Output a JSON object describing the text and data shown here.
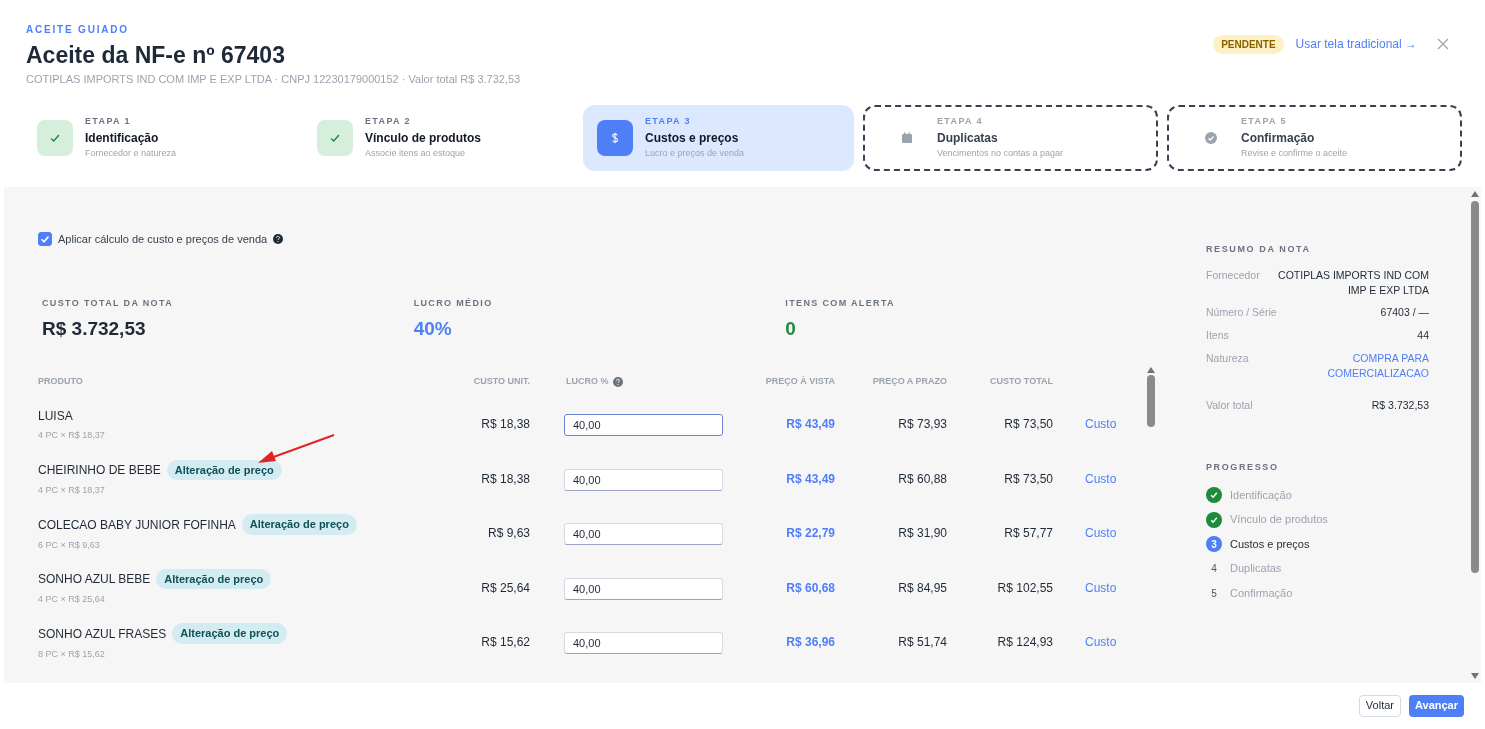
{
  "header": {
    "eyebrow": "ACEITE GUIADO",
    "title": "Aceite da NF-e nº 67403",
    "subtitle": "COTIPLAS IMPORTS IND COM IMP E EXP LTDA · CNPJ 12230179000152 · Valor total R$ 3.732,53",
    "status_badge": "PENDENTE",
    "traditional_link": "Usar tela tradicional →"
  },
  "steps": [
    {
      "label": "ETAPA 1",
      "title": "Identificação",
      "description": "Fornecedor e natureza",
      "kind": "done"
    },
    {
      "label": "ETAPA 2",
      "title": "Vínculo de produtos",
      "description": "Associe itens ao estoque",
      "kind": "done"
    },
    {
      "label": "ETAPA 3",
      "title": "Custos e preços",
      "description": "Lucro e preços de venda",
      "kind": "current"
    },
    {
      "label": "ETAPA 4",
      "title": "Duplicatas",
      "description": "Vencimentos no contas a pagar",
      "kind": "pending"
    },
    {
      "label": "ETAPA 5",
      "title": "Confirmação",
      "description": "Revise e confirme o aceite",
      "kind": "pending"
    }
  ],
  "apply_checkbox": {
    "label": "Aplicar cálculo de custo e preços de venda",
    "checked": true
  },
  "stats": [
    {
      "label": "CUSTO TOTAL DA NOTA",
      "value": "R$ 3.732,53",
      "color": "#1f2937"
    },
    {
      "label": "LUCRO MÉDIO",
      "value": "40%",
      "color": "#4f7ff7"
    },
    {
      "label": "ITENS COM ALERTA",
      "value": "0",
      "color": "#1e8a3c"
    }
  ],
  "table": {
    "columns": [
      "PRODUTO",
      "CUSTO UNIT.",
      "LUCRO %",
      "PREÇO À VISTA",
      "PREÇO A PRAZO",
      "CUSTO TOTAL"
    ],
    "rows": [
      {
        "product": "LUISA",
        "detail": "4 PC × R$ 18,37",
        "badge": "",
        "unit_cost": "R$ 18,38",
        "profit": "40,00",
        "focused": true,
        "cash_price": "R$ 43,49",
        "term_price": "R$ 73,93",
        "total_cost": "R$ 73,50",
        "action": "Custo"
      },
      {
        "product": "CHEIRINHO DE BEBE",
        "detail": "4 PC × R$ 18,37",
        "badge": "Alteração de preço",
        "unit_cost": "R$ 18,38",
        "profit": "40,00",
        "focused": false,
        "cash_price": "R$ 43,49",
        "term_price": "R$ 60,88",
        "total_cost": "R$ 73,50",
        "action": "Custo"
      },
      {
        "product": "COLECAO BABY JUNIOR FOFINHA",
        "detail": "6 PC × R$ 9,63",
        "badge": "Alteração de preço",
        "unit_cost": "R$ 9,63",
        "profit": "40,00",
        "focused": false,
        "cash_price": "R$ 22,79",
        "term_price": "R$ 31,90",
        "total_cost": "R$ 57,77",
        "action": "Custo"
      },
      {
        "product": "SONHO AZUL BEBE",
        "detail": "4 PC × R$ 25,64",
        "badge": "Alteração de preço",
        "unit_cost": "R$ 25,64",
        "profit": "40,00",
        "focused": false,
        "cash_price": "R$ 60,68",
        "term_price": "R$ 84,95",
        "total_cost": "R$ 102,55",
        "action": "Custo"
      },
      {
        "product": "SONHO AZUL FRASES",
        "detail": "8 PC × R$ 15,62",
        "badge": "Alteração de preço",
        "unit_cost": "R$ 15,62",
        "profit": "40,00",
        "focused": false,
        "cash_price": "R$ 36,96",
        "term_price": "R$ 51,74",
        "total_cost": "R$ 124,93",
        "action": "Custo"
      }
    ]
  },
  "summary": {
    "title": "RESUMO DA NOTA",
    "fields": [
      {
        "label": "Fornecedor",
        "value": "COTIPLAS IMPORTS IND COM IMP E EXP LTDA",
        "link": false
      },
      {
        "label": "Número / Série",
        "value": "67403 / —",
        "link": false
      },
      {
        "label": "Itens",
        "value": "44",
        "link": false
      },
      {
        "label": "Natureza",
        "value": "COMPRA PARA COMERCIALIZACAO",
        "link": true
      },
      {
        "label": "Valor total",
        "value": "R$ 3.732,53",
        "link": false
      }
    ]
  },
  "progress": {
    "title": "PROGRESSO",
    "items": [
      {
        "label": "Identificação",
        "kind": "done"
      },
      {
        "label": "Vínculo de produtos",
        "kind": "done"
      },
      {
        "marker": "3",
        "label": "Custos e preços",
        "kind": "current"
      },
      {
        "marker": "4",
        "label": "Duplicatas",
        "kind": "pending"
      },
      {
        "marker": "5",
        "label": "Confirmação",
        "kind": "pending"
      }
    ]
  },
  "footer": {
    "back": "Voltar",
    "next": "Avançar"
  }
}
